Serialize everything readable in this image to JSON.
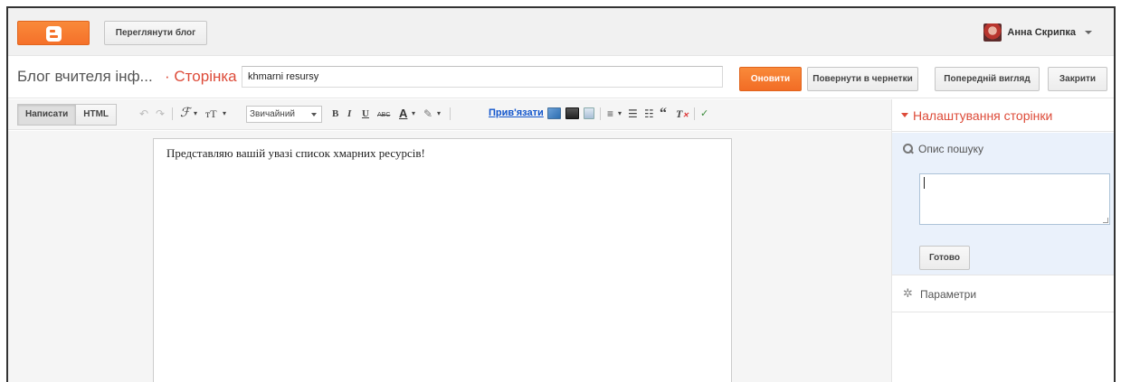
{
  "topbar": {
    "view_blog": "Переглянути блог",
    "user_name": "Анна Скрипка"
  },
  "titlebar": {
    "blog_title": "Блог вчителя інф...",
    "separator": "·",
    "page_label": "Сторінка",
    "page_title_value": "khmarni resursy",
    "update": "Оновити",
    "revert_to_draft": "Повернути в чернетки",
    "preview": "Попередній вигляд",
    "close": "Закрити"
  },
  "toolbar": {
    "compose": "Написати",
    "html": "HTML",
    "font_size_glyph": "тT",
    "format_select": "Звичайний",
    "bold": "B",
    "italic": "I",
    "underline": "U",
    "strike": "ABC",
    "text_color": "A",
    "link": "Прив'язати",
    "quote": "“",
    "clear": "T"
  },
  "editor": {
    "body_text": "Представляю вашій увазі список хмарних ресурсів!"
  },
  "sidebar": {
    "header": "Налаштування сторінки",
    "search_description": "Опис пошуку",
    "search_textarea_value": "",
    "done": "Готово",
    "options": "Параметри"
  },
  "colors": {
    "accent": "#dd4b39",
    "orange_button": "#f5712a",
    "link": "#1155cc"
  }
}
